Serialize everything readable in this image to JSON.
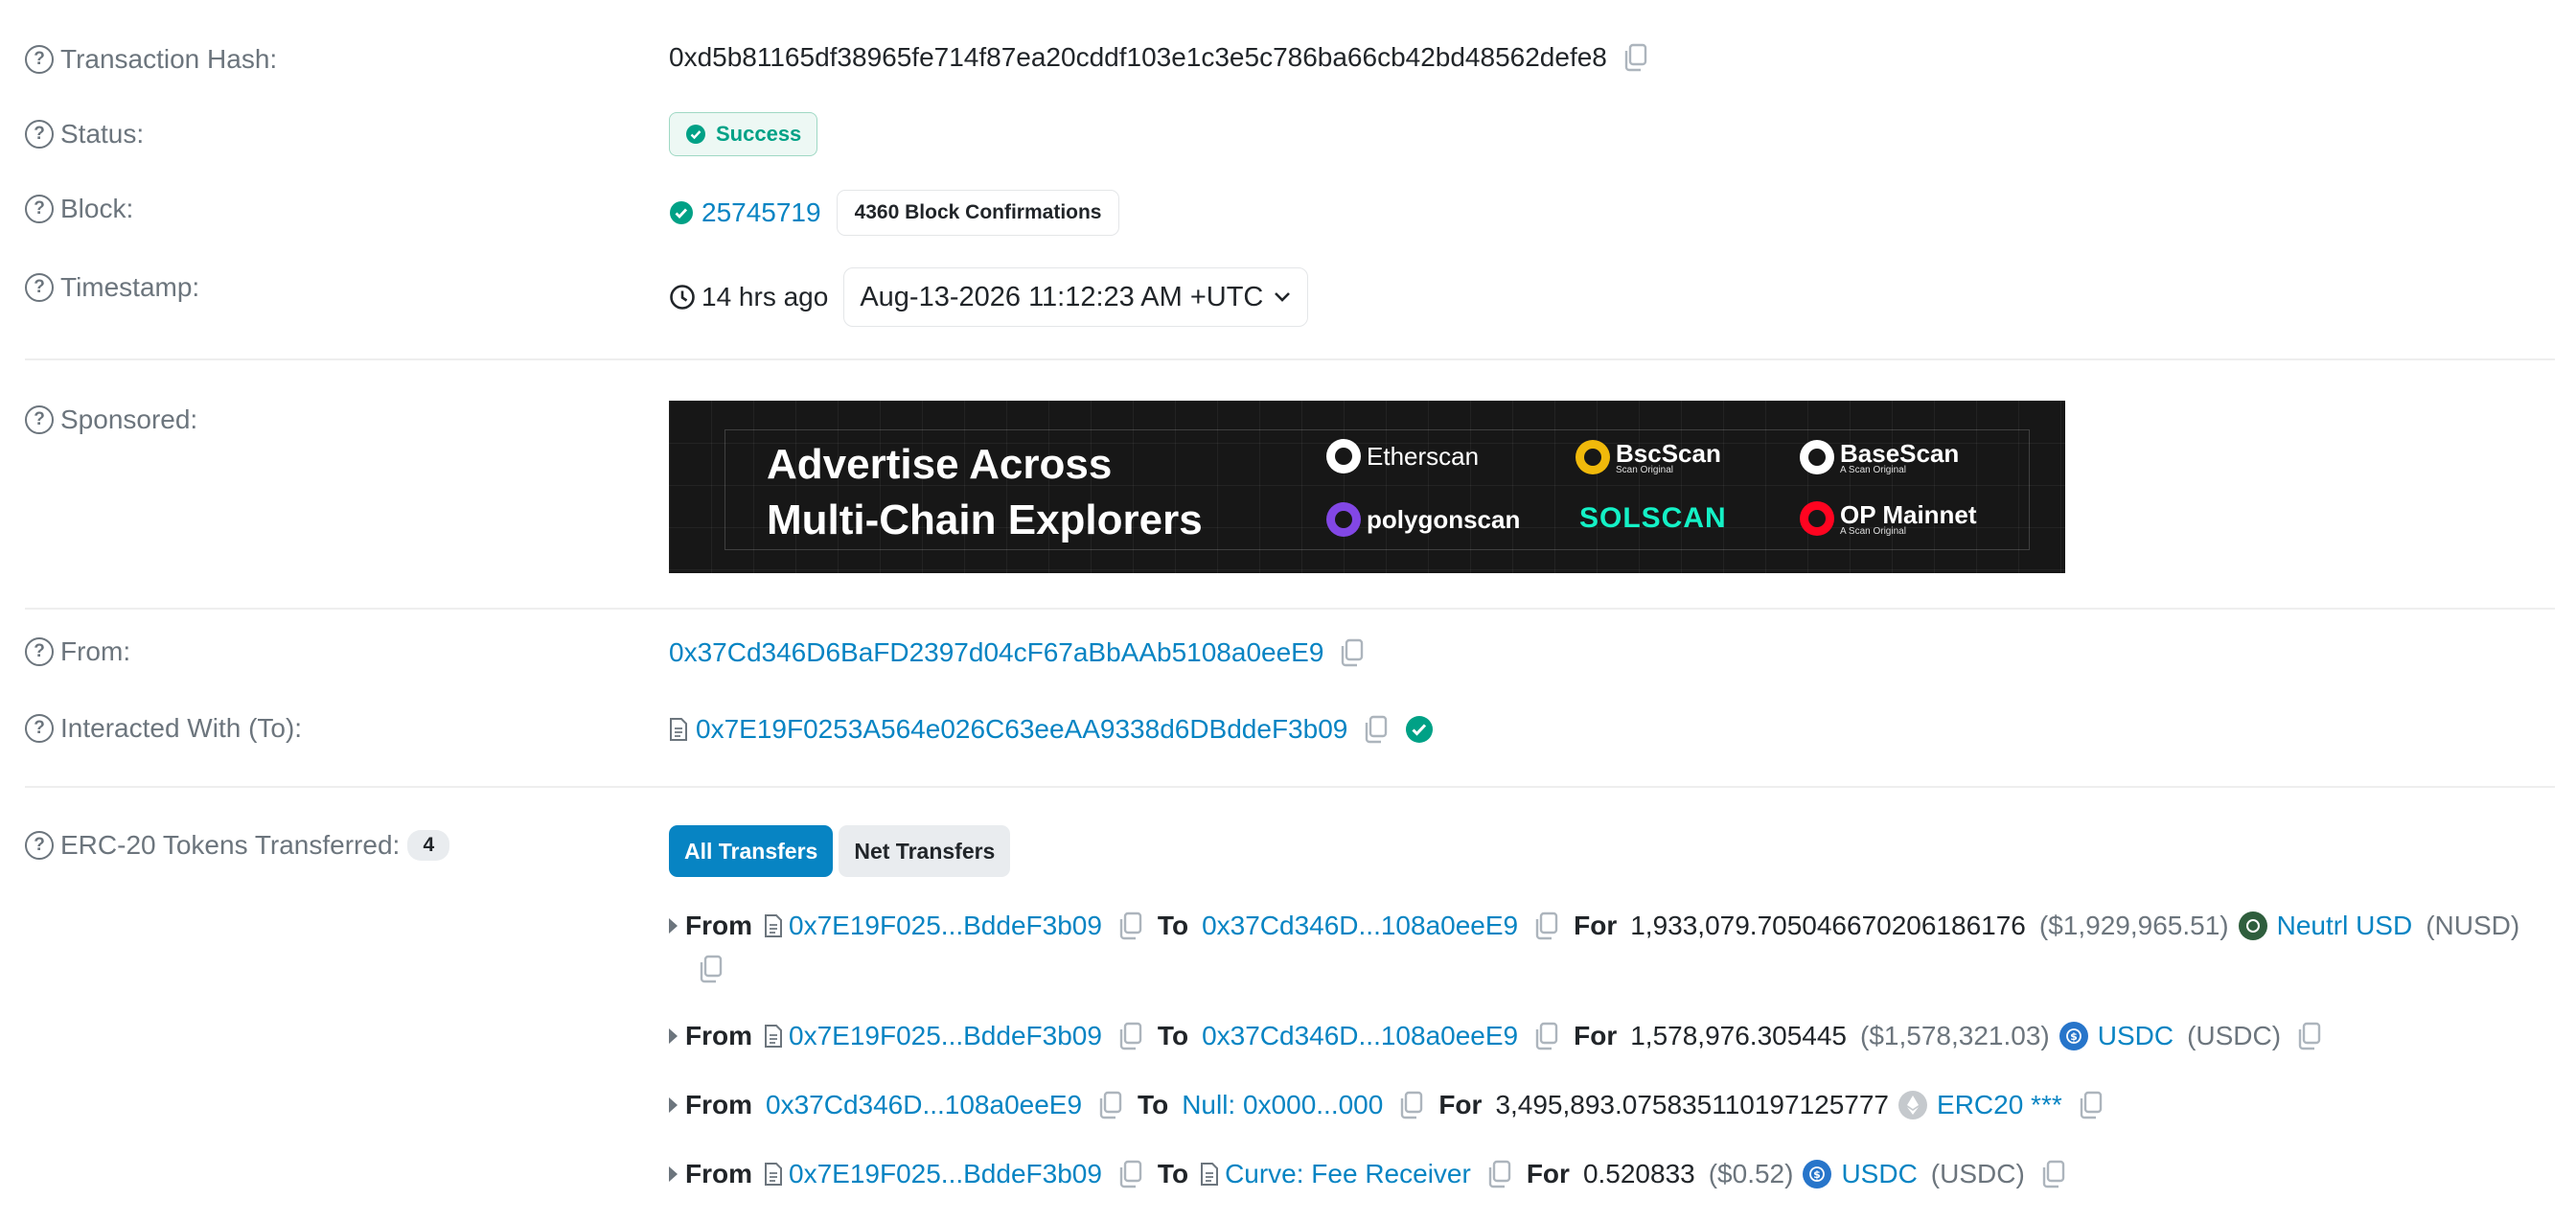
{
  "labels": {
    "tx_hash": "Transaction Hash:",
    "status": "Status:",
    "block": "Block:",
    "timestamp": "Timestamp:",
    "sponsored": "Sponsored:",
    "from": "From:",
    "interacted": "Interacted With (To):",
    "erc20": "ERC-20 Tokens Transferred:"
  },
  "tx_hash": "0xd5b81165df38965fe714f87ea20cddf103e1c3e5c786ba66cb42bd48562defe8",
  "status": "Success",
  "block": {
    "number": "25745719",
    "confirmations": "4360 Block Confirmations"
  },
  "timestamp": {
    "ago": "14 hrs ago",
    "full": "Aug-13-2026 11:12:23 AM +UTC"
  },
  "ad": {
    "line1": "Advertise Across",
    "line2": "Multi-Chain Explorers",
    "brands": [
      "Etherscan",
      "BscScan",
      "BaseScan",
      "polygonscan",
      "SOLSCAN",
      "OP Mainnet"
    ],
    "brand_subs": [
      "Scan Original",
      "A Scan Original",
      "A Scan Original"
    ]
  },
  "from_address": "0x37Cd346D6BaFD2397d04cF67aBbAAb5108a0eeE9",
  "to_address": "0x7E19F0253A564e026C63eeAA9338d6DBddeF3b09",
  "erc20": {
    "count": "4",
    "tab_all": "All Transfers",
    "tab_net": "Net Transfers",
    "words": {
      "from": "From",
      "to": "To",
      "for": "For"
    },
    "transfers": [
      {
        "from": "0x7E19F025...BddeF3b09",
        "to": "0x37Cd346D...108a0eeE9",
        "amount": "1,933,079.705046670206186176",
        "usd": "($1,929,965.51)",
        "token": "Neutrl USD",
        "symbol": "(NUSD)"
      },
      {
        "from": "0x7E19F025...BddeF3b09",
        "to": "0x37Cd346D...108a0eeE9",
        "amount": "1,578,976.305445",
        "usd": "($1,578,321.03)",
        "token": "USDC",
        "symbol": "(USDC)"
      },
      {
        "from": "0x37Cd346D...108a0eeE9",
        "to": "Null: 0x000...000",
        "amount": "3,495,893.075835110197125777",
        "token": "ERC20 ***"
      },
      {
        "from": "0x7E19F025...BddeF3b09",
        "to": "Curve: Fee Receiver",
        "amount": "0.520833",
        "usd": "($0.52)",
        "token": "USDC",
        "symbol": "(USDC)"
      }
    ]
  },
  "colors": {
    "link": "#0784c3",
    "success": "#00a186",
    "muted": "#6c757d",
    "ad_bg": "#171717"
  }
}
